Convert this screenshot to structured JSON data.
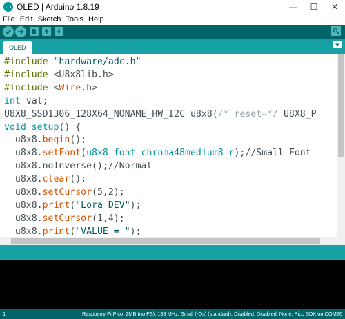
{
  "window": {
    "title": "OLED | Arduino 1.8.19",
    "controls": {
      "minimize": "—",
      "maximize": "☐",
      "close": "✕"
    }
  },
  "menu": [
    "File",
    "Edit",
    "Sketch",
    "Tools",
    "Help"
  ],
  "tabs": [
    {
      "label": "OLED",
      "active": true
    }
  ],
  "colors": {
    "toolbar": "#006468",
    "tabbar": "#17a1a5",
    "keyword_type": "#00979c",
    "keyword_function": "#d35400",
    "directive": "#5e6d03",
    "string": "#005c5f",
    "comment": "#95a5a6"
  },
  "editor": {
    "lines": [
      [
        {
          "t": "#include",
          "c": "dir"
        },
        {
          "t": " ",
          "c": ""
        },
        {
          "t": "\"hardware/adc.h\"",
          "c": "str"
        }
      ],
      [
        {
          "t": "#include",
          "c": "dir"
        },
        {
          "t": " <U8x8lib.h>",
          "c": ""
        }
      ],
      [
        {
          "t": "#include",
          "c": "dir"
        },
        {
          "t": " <",
          "c": ""
        },
        {
          "t": "Wire",
          "c": "fn"
        },
        {
          "t": ".h>",
          "c": ""
        }
      ],
      [
        {
          "t": "int",
          "c": "type"
        },
        {
          "t": " val;",
          "c": ""
        }
      ],
      [
        {
          "t": "U8X8_SSD1306_128X64_NONAME_HW_I2C u8x8(",
          "c": ""
        },
        {
          "t": "/* reset=*/",
          "c": "cmt"
        },
        {
          "t": " U8X8_P",
          "c": ""
        }
      ],
      [
        {
          "t": "void",
          "c": "type"
        },
        {
          "t": " ",
          "c": ""
        },
        {
          "t": "setup",
          "c": "type"
        },
        {
          "t": "() {",
          "c": ""
        }
      ],
      [
        {
          "t": "  u8x8.",
          "c": ""
        },
        {
          "t": "begin",
          "c": "fn"
        },
        {
          "t": "();",
          "c": ""
        }
      ],
      [
        {
          "t": "  u8x8.",
          "c": ""
        },
        {
          "t": "setFont",
          "c": "fn"
        },
        {
          "t": "(",
          "c": ""
        },
        {
          "t": "u8x8_font_chroma48medium8_r",
          "c": "type"
        },
        {
          "t": ");",
          "c": ""
        },
        {
          "t": "//Small Font",
          "c": ""
        }
      ],
      [
        {
          "t": "  u8x8.noInverse();//Normal",
          "c": ""
        }
      ],
      [
        {
          "t": "  u8x8.",
          "c": ""
        },
        {
          "t": "clear",
          "c": "fn"
        },
        {
          "t": "();",
          "c": ""
        }
      ],
      [
        {
          "t": "  u8x8.",
          "c": ""
        },
        {
          "t": "setCursor",
          "c": "fn"
        },
        {
          "t": "(5,2);",
          "c": ""
        }
      ],
      [
        {
          "t": "  u8x8.",
          "c": ""
        },
        {
          "t": "print",
          "c": "fn"
        },
        {
          "t": "(",
          "c": ""
        },
        {
          "t": "\"Lora DEV\"",
          "c": "str"
        },
        {
          "t": ");",
          "c": ""
        }
      ],
      [
        {
          "t": "  u8x8.",
          "c": ""
        },
        {
          "t": "setCursor",
          "c": "fn"
        },
        {
          "t": "(1,4);",
          "c": ""
        }
      ],
      [
        {
          "t": "  u8x8.",
          "c": ""
        },
        {
          "t": "print",
          "c": "fn"
        },
        {
          "t": "(",
          "c": ""
        },
        {
          "t": "\"VALUE = \"",
          "c": "str"
        },
        {
          "t": ");",
          "c": ""
        }
      ]
    ]
  },
  "status": {
    "line_number": "1",
    "board": "Raspberry Pi Pico, 2MB (no FS), 133 MHz, Small (-Os) (standard), Disabled, Disabled, None, Pico SDK on COM26"
  }
}
